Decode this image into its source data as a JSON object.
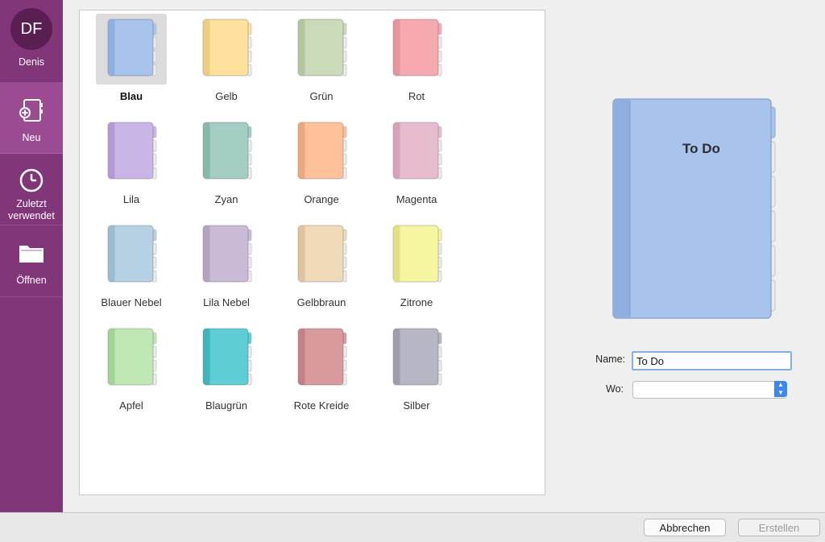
{
  "sidebar": {
    "user": {
      "initials": "DF",
      "name": "Denis"
    },
    "items": [
      {
        "label": "Neu",
        "icon": "new-notebook-icon",
        "selected": true
      },
      {
        "label": "Zuletzt verwendet",
        "icon": "clock-icon"
      },
      {
        "label": "Öffnen",
        "icon": "folder-icon"
      }
    ]
  },
  "notebooks": [
    {
      "label": "Blau",
      "color": "#a9c4ec",
      "spine": "#8fb0df",
      "selected": true
    },
    {
      "label": "Gelb",
      "color": "#fde19c",
      "spine": "#eccd82"
    },
    {
      "label": "Grün",
      "color": "#cbdab8",
      "spine": "#b1c79e"
    },
    {
      "label": "Rot",
      "color": "#f6aab0",
      "spine": "#e5959c"
    },
    {
      "label": "Lila",
      "color": "#c9b5e6",
      "spine": "#b29ad6"
    },
    {
      "label": "Zyan",
      "color": "#a4cec4",
      "spine": "#88b7ab"
    },
    {
      "label": "Orange",
      "color": "#fec199",
      "spine": "#eca87c"
    },
    {
      "label": "Magenta",
      "color": "#e8bccf",
      "spine": "#d7a2b8"
    },
    {
      "label": "Blauer Nebel",
      "color": "#b5d1e3",
      "spine": "#9bbbd1"
    },
    {
      "label": "Lila Nebel",
      "color": "#c9bbd6",
      "spine": "#b3a3c3"
    },
    {
      "label": "Gelbbraun",
      "color": "#f1dab8",
      "spine": "#dfc49f"
    },
    {
      "label": "Zitrone",
      "color": "#f6f5a0",
      "spine": "#e3e185"
    },
    {
      "label": "Apfel",
      "color": "#bfe8b4",
      "spine": "#a2d497"
    },
    {
      "label": "Blaugrün",
      "color": "#5dcfd4",
      "spine": "#3fb4ba"
    },
    {
      "label": "Rote Kreide",
      "color": "#d89a9c",
      "spine": "#c48083"
    },
    {
      "label": "Silber",
      "color": "#b6b6c4",
      "spine": "#9d9dae"
    }
  ],
  "preview": {
    "title": "To Do",
    "color": "#a9c4ec",
    "spine": "#8fb0df"
  },
  "form": {
    "name_label": "Name:",
    "name_value": "To Do",
    "wo_label": "Wo:",
    "wo_value": ""
  },
  "footer": {
    "cancel_label": "Abbrechen",
    "create_label": "Erstellen"
  }
}
